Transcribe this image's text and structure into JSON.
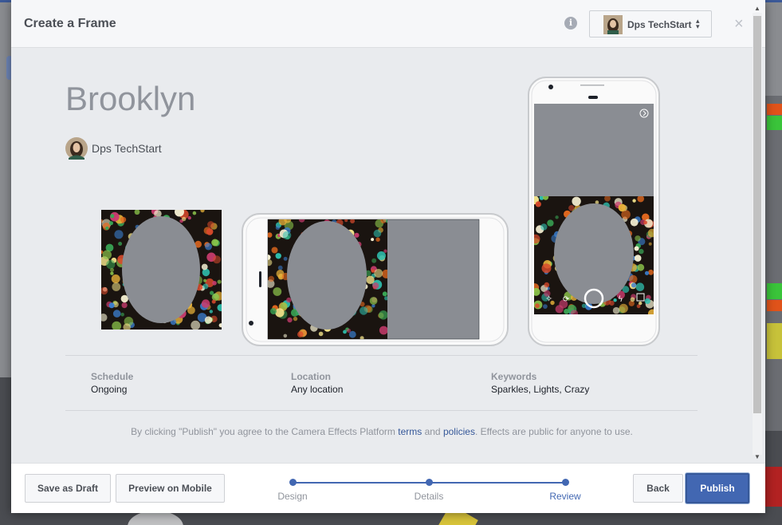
{
  "dialog": {
    "title": "Create a Frame",
    "info_icon": "i",
    "account": {
      "name": "Dps TechStart",
      "chevron": "▴▾"
    },
    "close": "×"
  },
  "frame": {
    "name": "Brooklyn",
    "creator": "Dps TechStart"
  },
  "details": [
    {
      "label": "Schedule",
      "value": "Ongoing"
    },
    {
      "label": "Location",
      "value": "Any location"
    },
    {
      "label": "Keywords",
      "value": "Sparkles, Lights, Crazy"
    }
  ],
  "legal": {
    "before": "By clicking \"Publish\" you agree to the Camera Effects Platform ",
    "terms": "terms",
    "and": " and ",
    "policies": "policies",
    "after": ". Effects are public for anyone to use."
  },
  "footer": {
    "save_draft": "Save as Draft",
    "preview_mobile": "Preview on Mobile",
    "back": "Back",
    "publish": "Publish"
  },
  "steps": [
    {
      "label": "Design",
      "active": false
    },
    {
      "label": "Details",
      "active": false
    },
    {
      "label": "Review",
      "active": true
    }
  ],
  "colors": {
    "accent": "#4267b2",
    "gray_placeholder": "#8a8d93"
  },
  "icons": [
    "info-icon",
    "chevron-up-down-icon",
    "close-icon",
    "sparkle-icon",
    "camera-switch-icon",
    "shutter-button",
    "flash-icon",
    "gallery-icon",
    "arrow-right-icon"
  ]
}
